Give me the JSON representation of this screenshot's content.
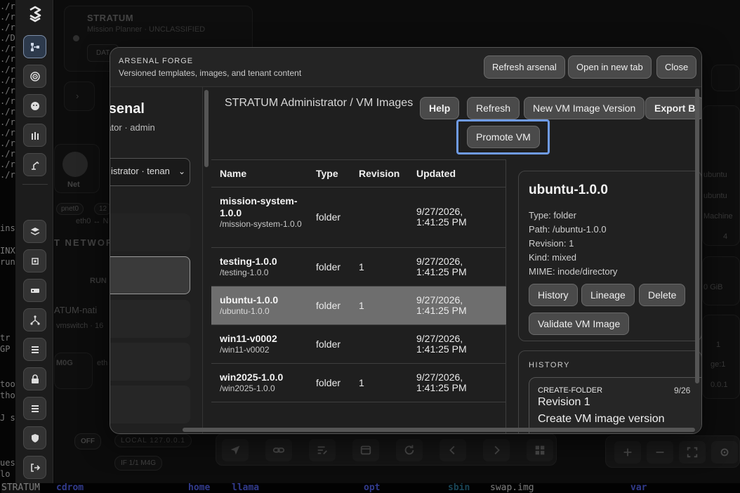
{
  "terminal": {
    "side_lines": [
      "./r",
      "./r",
      "./r",
      "./D",
      "./r",
      "./r",
      "./r",
      "./r",
      "./r",
      "./r",
      "./r",
      "./r",
      "./r",
      "./r",
      "./r",
      "./r",
      "./r"
    ],
    "snippets": [
      "ins",
      "INX",
      "run",
      "tr",
      "GP",
      "too",
      "tho",
      "J s",
      "ues",
      "lo",
      "STRATUM"
    ],
    "bottom_dirs": [
      "cdrom",
      "home",
      "llama",
      "opt",
      "sbin",
      "swap.img",
      "var"
    ]
  },
  "sidebar": {
    "icons": [
      "stratum-logo-icon",
      "topology-icon",
      "radar-icon",
      "agent-icon",
      "arsenal-icon",
      "robot-arm-icon",
      "layers-icon",
      "chip-icon",
      "server-icon",
      "network-icon",
      "list-icon",
      "lock-icon",
      "stack-icon",
      "shield-icon",
      "logout-icon"
    ]
  },
  "background": {
    "app_title": "STRATUM",
    "app_subtitle": "Mission Planner · UNCLASSIFIED",
    "date_chip": "DAT",
    "net_label": "Net",
    "pnet": "pnet0",
    "pnet_short": "12",
    "eth_label": "eth0 ↔ N",
    "network_label": "T NETWOR",
    "run_label": "RUN",
    "stratum_nati": "ATUM-nati",
    "vmswitch": "vmswitch · 16",
    "mog": "M0G",
    "eth": "eth",
    "off": "OFF",
    "local": "LOCAL",
    "local_ip": "127.0.0.1",
    "if_label": "IF",
    "if_value": "1/1",
    "m4g": "M4G",
    "right_texts": [
      "ubuntu",
      "ubuntu",
      "Machine",
      "4",
      "0 GiB",
      "1",
      "ge:1",
      "0.0.1"
    ]
  },
  "modal": {
    "kicker": "ARSENAL FORGE",
    "subtitle": "Versioned templates, images, and tenant content",
    "header_buttons": [
      "Refresh arsenal",
      "Open in new tab",
      "Close"
    ],
    "left_pane": {
      "title": "rsenal",
      "subtitle": "rator · admin",
      "select_value": "istrator · tenan"
    },
    "path": "STRATUM Administrator / VM Images",
    "actions": [
      "Help",
      "Refresh",
      "New VM Image Version",
      "Export B"
    ],
    "promote_label": "Promote VM",
    "table": {
      "headers": [
        "Name",
        "Type",
        "Revision",
        "Updated"
      ],
      "rows": [
        {
          "name": "mission-system-1.0.0",
          "path": "/mission-system-1.0.0",
          "type": "folder",
          "revision": "",
          "updated": "9/27/2026, 1:41:25 PM"
        },
        {
          "name": "testing-1.0.0",
          "path": "/testing-1.0.0",
          "type": "folder",
          "revision": "1",
          "updated": "9/27/2026, 1:41:25 PM"
        },
        {
          "name": "ubuntu-1.0.0",
          "path": "/ubuntu-1.0.0",
          "type": "folder",
          "revision": "1",
          "updated": "9/27/2026, 1:41:25 PM"
        },
        {
          "name": "win11-v0002",
          "path": "/win11-v0002",
          "type": "folder",
          "revision": "",
          "updated": "9/27/2026, 1:41:25 PM"
        },
        {
          "name": "win2025-1.0.0",
          "path": "/win2025-1.0.0",
          "type": "folder",
          "revision": "1",
          "updated": "9/27/2026, 1:41:25 PM"
        }
      ]
    },
    "detail": {
      "title": "ubuntu-1.0.0",
      "type_line": "Type: folder",
      "path_line": "Path: /ubuntu-1.0.0",
      "revision_line": "Revision: 1",
      "kind_line": "Kind: mixed",
      "mime_line": "MIME: inode/directory",
      "buttons": [
        "History",
        "Lineage",
        "Delete"
      ],
      "validate_label": "Validate VM Image"
    },
    "history": {
      "label": "HISTORY",
      "item": {
        "kind": "CREATE-FOLDER",
        "date": "9/26",
        "revision": "Revision 1",
        "message": "Create VM image version"
      }
    }
  },
  "colors": {
    "focus_ring": "#6f9be6",
    "selected_row": "#6e6e6e",
    "button_bg": "#4a4a4a"
  }
}
